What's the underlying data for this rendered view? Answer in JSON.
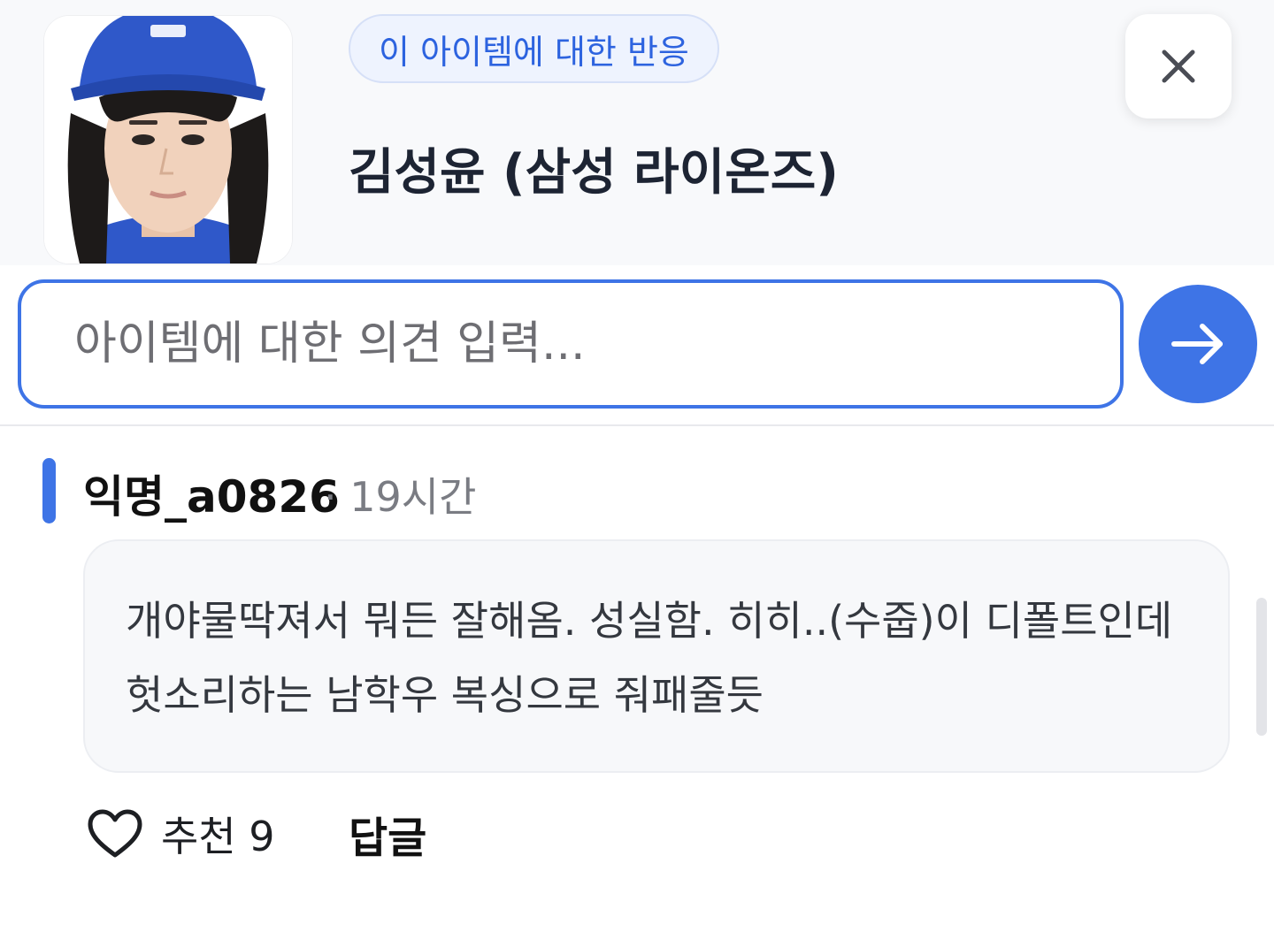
{
  "header": {
    "tag_label": "이 아이템에 대한 반응",
    "title": "김성윤 (삼성 라이온즈)",
    "thumbnail_alt": "player-photo",
    "close_icon": "close-icon"
  },
  "input": {
    "placeholder": "아이템에 대한 의견 입력...",
    "value": "",
    "send_icon": "arrow-right-icon"
  },
  "comment": {
    "author": "익명_a0826",
    "time": "· 19시간",
    "text": "개야물딱져서 뭐든 잘해옴. 성실함. 히히..(수줍)이 디폴트인데 헛소리하는 남학우 복싱으로 줘패줄듯",
    "like_label": "추천 9",
    "reply_label": "답글"
  },
  "colors": {
    "accent": "#3e74e6",
    "tag_text": "#2d63df",
    "cap": "#2f58c9"
  }
}
